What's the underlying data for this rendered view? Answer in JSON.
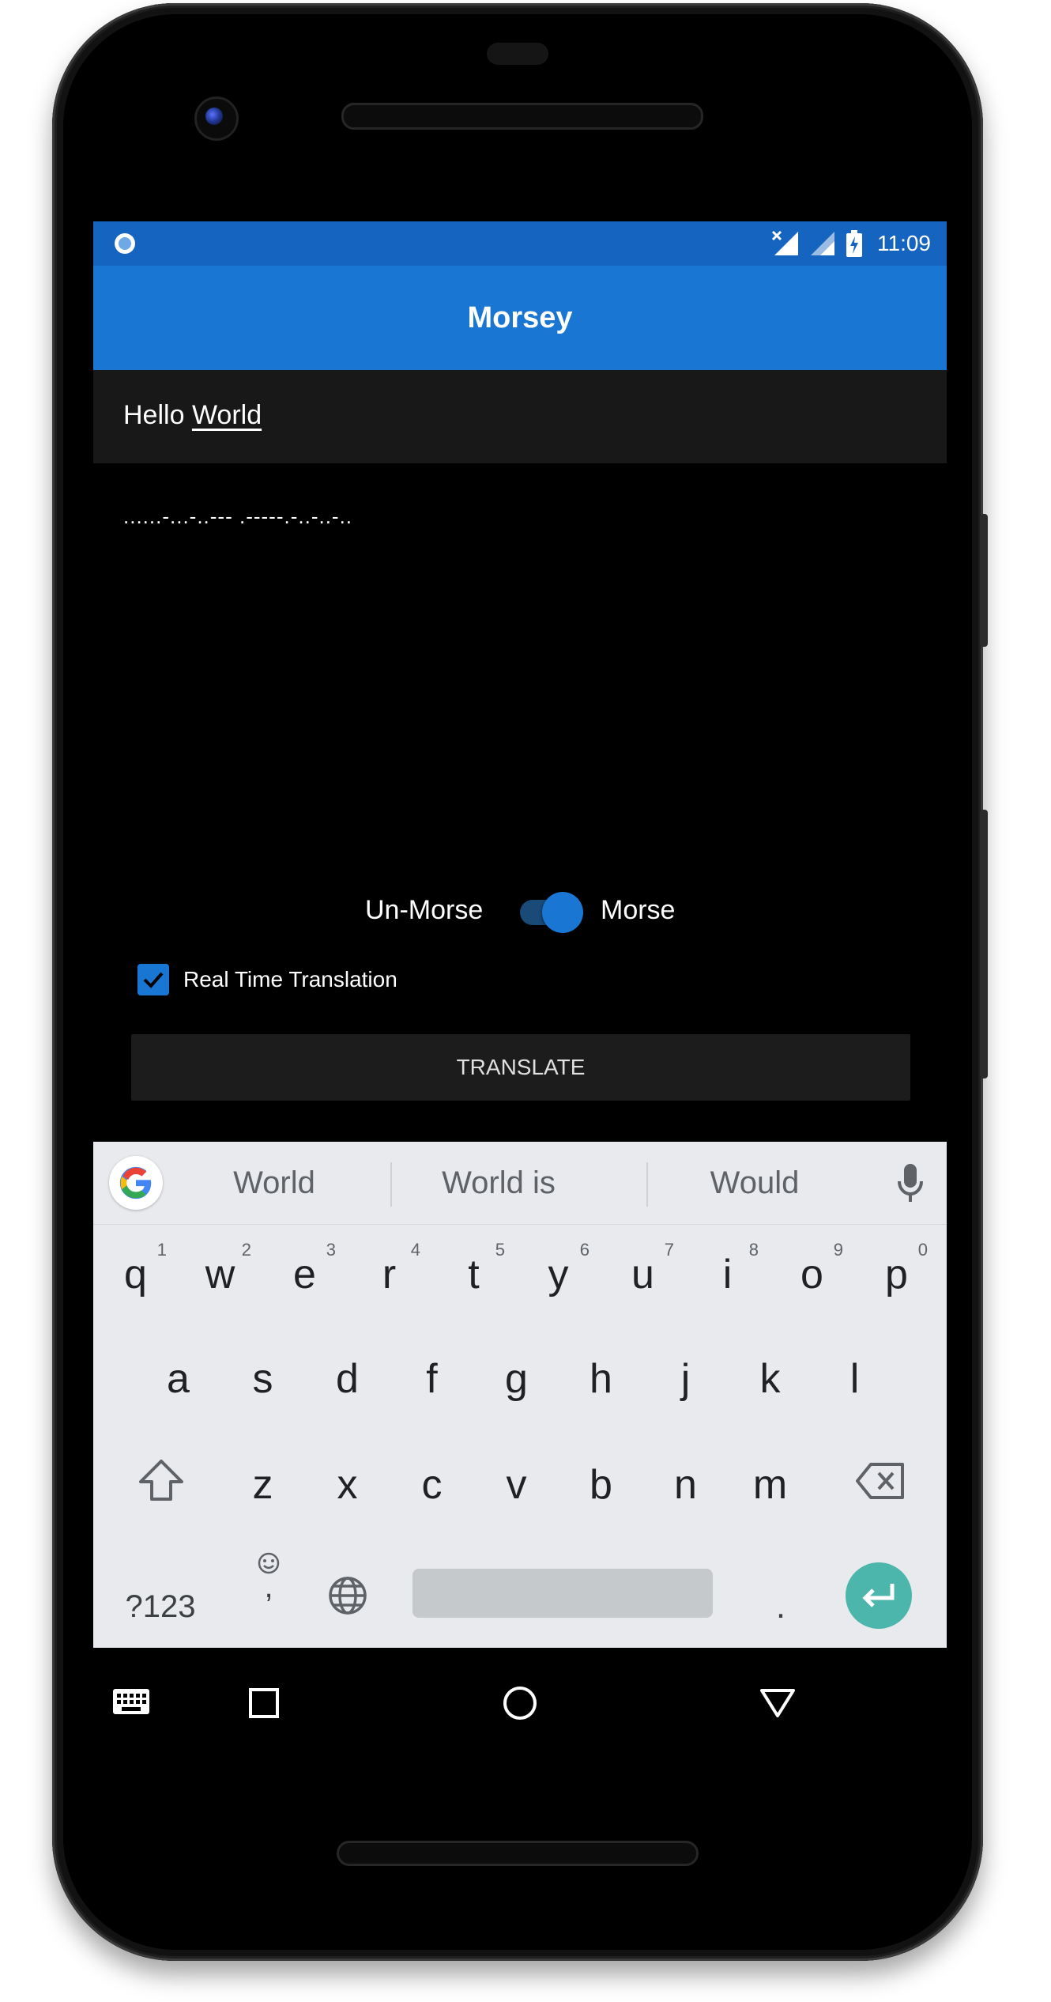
{
  "status_bar": {
    "time": "11:09"
  },
  "app_bar": {
    "title": "Morsey"
  },
  "input": {
    "word1": "Hello",
    "word2": "World"
  },
  "output": {
    "morse": "......-...-..--- .-----.-..-..-.."
  },
  "mode_toggle": {
    "left_label": "Un-Morse",
    "right_label": "Morse",
    "on": true
  },
  "realtime": {
    "label": "Real Time Translation",
    "checked": true
  },
  "translate_button": {
    "label": "TRANSLATE"
  },
  "keyboard": {
    "suggestions": [
      "World",
      "World is",
      "Would"
    ],
    "row1": [
      {
        "k": "q",
        "h": "1"
      },
      {
        "k": "w",
        "h": "2"
      },
      {
        "k": "e",
        "h": "3"
      },
      {
        "k": "r",
        "h": "4"
      },
      {
        "k": "t",
        "h": "5"
      },
      {
        "k": "y",
        "h": "6"
      },
      {
        "k": "u",
        "h": "7"
      },
      {
        "k": "i",
        "h": "8"
      },
      {
        "k": "o",
        "h": "9"
      },
      {
        "k": "p",
        "h": "0"
      }
    ],
    "row2": [
      "a",
      "s",
      "d",
      "f",
      "g",
      "h",
      "j",
      "k",
      "l"
    ],
    "row3": [
      "z",
      "x",
      "c",
      "v",
      "b",
      "n",
      "m"
    ],
    "num_key": "?123",
    "emoji_key": ",",
    "period_key": "."
  },
  "colors": {
    "status_bar": "#1565c0",
    "app_bar": "#1976d2",
    "accent": "#1976d2",
    "enter_key": "#4db6ac"
  },
  "icons": [
    "circle-notification-icon",
    "wifi-off-icon",
    "signal-icon",
    "battery-charging-icon",
    "google-g-icon",
    "mic-icon",
    "shift-icon",
    "delete-icon",
    "emoji-icon",
    "globe-icon",
    "enter-icon",
    "keyboard-icon",
    "recents-icon",
    "home-icon",
    "back-icon"
  ]
}
